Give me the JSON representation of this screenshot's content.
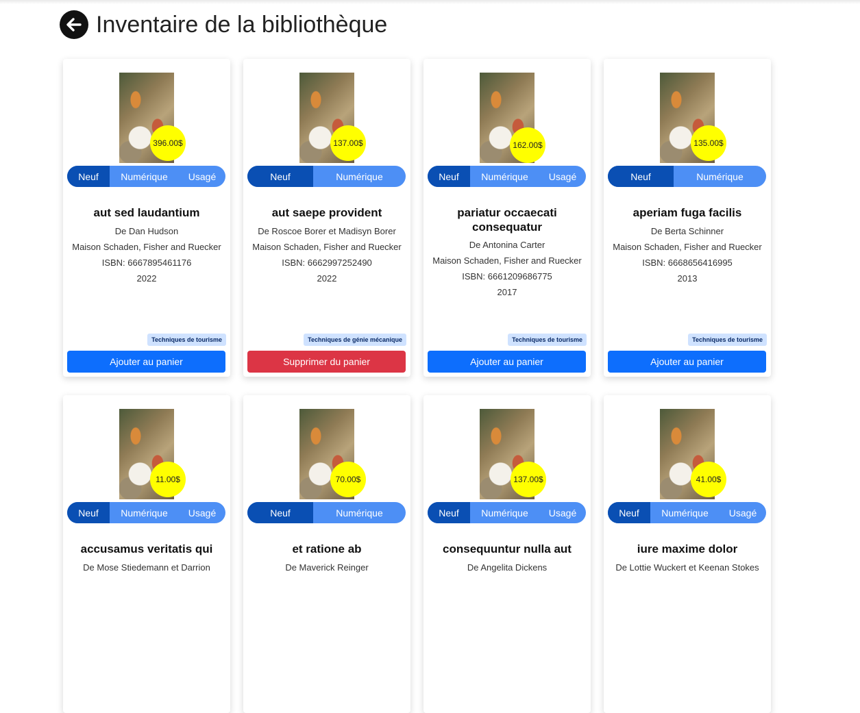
{
  "page": {
    "title": "Inventaire de la bibliothèque"
  },
  "icons": {
    "back": "arrow-left-circle-icon"
  },
  "colors": {
    "price_badge": "#ffff00",
    "format_selected": "#0a4fb3",
    "format_bar": "#4d8ff5",
    "add_button": "#0d6efd",
    "remove_button": "#dc3545",
    "tag_bg": "#cfe2ff"
  },
  "books": [
    {
      "price": "396.00$",
      "formats": [
        "Neuf",
        "Numérique",
        "Usagé"
      ],
      "selected": "Neuf",
      "title": "aut sed laudantium",
      "author": "De Dan Hudson",
      "publisher": "Maison Schaden, Fisher and Ruecker",
      "isbn": "ISBN: 6667895461176",
      "year": "2022",
      "tag": "Techniques de tourisme",
      "action": "Ajouter au panier",
      "action_type": "add"
    },
    {
      "price": "137.00$",
      "formats": [
        "Neuf",
        "Numérique"
      ],
      "selected": "Neuf",
      "title": "aut saepe provident",
      "author": "De Roscoe Borer et Madisyn Borer",
      "publisher": "Maison Schaden, Fisher and Ruecker",
      "isbn": "ISBN: 6662997252490",
      "year": "2022",
      "tag": "Techniques de génie mécanique",
      "action": "Supprimer du panier",
      "action_type": "remove"
    },
    {
      "price": "162.00$",
      "formats": [
        "Neuf",
        "Numérique",
        "Usagé"
      ],
      "selected": "Neuf",
      "title": "pariatur occaecati consequatur",
      "author": "De Antonina Carter",
      "publisher": "Maison Schaden, Fisher and Ruecker",
      "isbn": "ISBN: 6661209686775",
      "year": "2017",
      "tag": "Techniques de tourisme",
      "action": "Ajouter au panier",
      "action_type": "add"
    },
    {
      "price": "135.00$",
      "formats": [
        "Neuf",
        "Numérique"
      ],
      "selected": "Neuf",
      "title": "aperiam fuga facilis",
      "author": "De Berta Schinner",
      "publisher": "Maison Schaden, Fisher and Ruecker",
      "isbn": "ISBN: 6668656416995",
      "year": "2013",
      "tag": "Techniques de tourisme",
      "action": "Ajouter au panier",
      "action_type": "add"
    },
    {
      "price": "11.00$",
      "formats": [
        "Neuf",
        "Numérique",
        "Usagé"
      ],
      "selected": "Neuf",
      "title": "accusamus veritatis qui",
      "author": "De Mose Stiedemann et Darrion"
    },
    {
      "price": "70.00$",
      "formats": [
        "Neuf",
        "Numérique"
      ],
      "selected": "Neuf",
      "title": "et ratione ab",
      "author": "De Maverick Reinger"
    },
    {
      "price": "137.00$",
      "formats": [
        "Neuf",
        "Numérique",
        "Usagé"
      ],
      "selected": "Neuf",
      "title": "consequuntur nulla aut",
      "author": "De Angelita Dickens"
    },
    {
      "price": "41.00$",
      "formats": [
        "Neuf",
        "Numérique",
        "Usagé"
      ],
      "selected": "Neuf",
      "title": "iure maxime dolor",
      "author": "De Lottie Wuckert et Keenan Stokes"
    }
  ]
}
